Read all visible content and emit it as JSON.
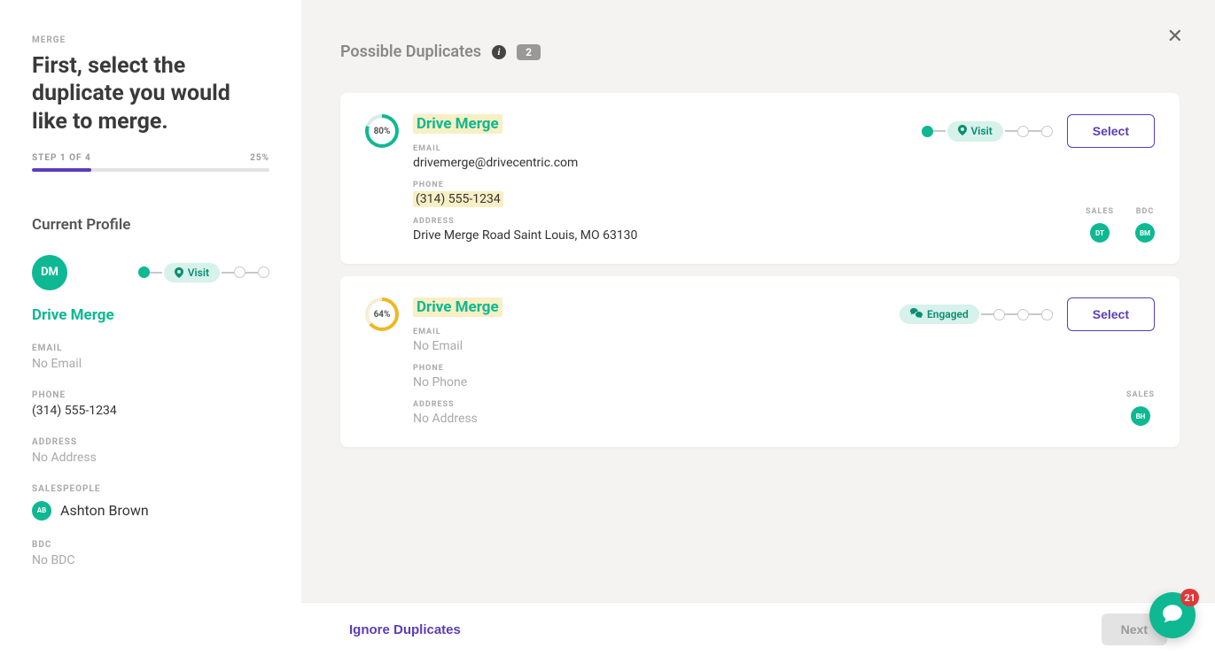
{
  "sidebar": {
    "label": "MERGE",
    "title": "First, select the duplicate you would like to merge.",
    "step_text": "STEP 1 OF 4",
    "progress_pct": "25%",
    "progress_width": 25,
    "section_heading": "Current Profile",
    "avatar_initials": "DM",
    "stage_label": "Visit",
    "profile_name": "Drive Merge",
    "fields": {
      "email_label": "EMAIL",
      "email_value": "No Email",
      "phone_label": "PHONE",
      "phone_value": "(314) 555-1234",
      "address_label": "ADDRESS",
      "address_value": "No Address",
      "salespeople_label": "SALESPEOPLE",
      "salesperson_initials": "AB",
      "salesperson_name": "Ashton Brown",
      "bdc_label": "BDC",
      "bdc_value": "No BDC"
    }
  },
  "main": {
    "title": "Possible Duplicates",
    "count": "2"
  },
  "cards": [
    {
      "match_pct": "80%",
      "ring_class": "ring-80",
      "name": "Drive Merge",
      "email_label": "EMAIL",
      "email_value": "drivemerge@drivecentric.com",
      "email_muted": false,
      "phone_label": "PHONE",
      "phone_value": "(314) 555-1234",
      "phone_highlight": true,
      "phone_muted": false,
      "address_label": "ADDRESS",
      "address_value": "Drive Merge Road Saint Louis, MO 63130",
      "address_muted": false,
      "stage_label": "Visit",
      "stage_type": "visit",
      "select_label": "Select",
      "roles": [
        {
          "label": "SALES",
          "initials": "DT",
          "color": "#0eb893"
        },
        {
          "label": "BDC",
          "initials": "BM",
          "color": "#0eb893"
        }
      ]
    },
    {
      "match_pct": "64%",
      "ring_class": "ring-64",
      "name": "Drive Merge",
      "email_label": "EMAIL",
      "email_value": "No Email",
      "email_muted": true,
      "phone_label": "PHONE",
      "phone_value": "No Phone",
      "phone_highlight": false,
      "phone_muted": true,
      "address_label": "ADDRESS",
      "address_value": "No Address",
      "address_muted": true,
      "stage_label": "Engaged",
      "stage_type": "engaged",
      "select_label": "Select",
      "roles": [
        {
          "label": "SALES",
          "initials": "BH",
          "color": "#0eb893"
        }
      ]
    }
  ],
  "footer": {
    "ignore_label": "Ignore Duplicates",
    "next_label": "Next"
  },
  "chat": {
    "count": "21"
  },
  "colors": {
    "salesperson_avatar": "#0eb893"
  }
}
